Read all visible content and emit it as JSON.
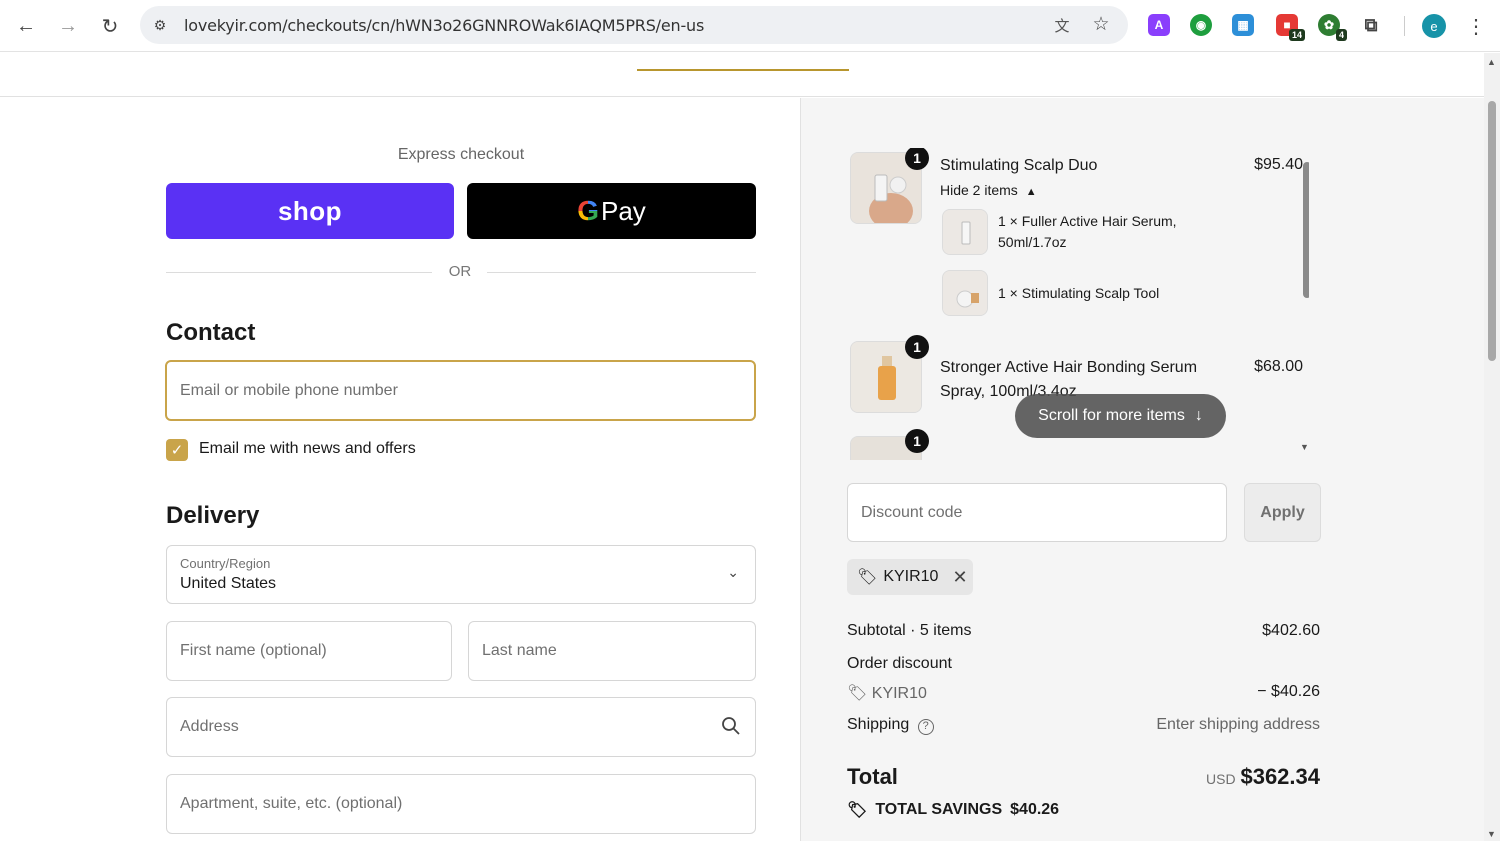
{
  "browser": {
    "url": "lovekyir.com/checkouts/cn/hWN3o26GNNROWak6IAQM5PRS/en-us",
    "extensions": [
      {
        "name": "a-extension-icon",
        "glyph": "A",
        "color": "#8a3ffc"
      },
      {
        "name": "green-extension-icon",
        "glyph": "◉",
        "color": "#1e9e3e"
      },
      {
        "name": "grid-extension-icon",
        "glyph": "▦",
        "color": "#2d8fd8"
      },
      {
        "name": "red-extension-icon",
        "glyph": "■",
        "color": "#e53935",
        "badge": "14"
      },
      {
        "name": "puzzle-green-extension-icon",
        "glyph": "✿",
        "color": "#2e7d32",
        "badge": "4"
      }
    ],
    "avatar_letter": "e"
  },
  "checkout": {
    "express_title": "Express checkout",
    "shop_label": "shop",
    "gpay_label": "Pay",
    "gpay_g": "G",
    "or_label": "OR",
    "contact_heading": "Contact",
    "email_placeholder": "Email or mobile phone number",
    "newsletter_label": "Email me with news and offers",
    "newsletter_checked": true,
    "delivery_heading": "Delivery",
    "country_label": "Country/Region",
    "country_value": "United States",
    "first_name_placeholder": "First name (optional)",
    "last_name_placeholder": "Last name",
    "address_placeholder": "Address",
    "apartment_placeholder": "Apartment, suite, etc. (optional)"
  },
  "summary": {
    "items": [
      {
        "qty": "1",
        "title": "Stimulating Scalp Duo",
        "price": "$95.40",
        "toggle_label": "Hide 2 items",
        "sub_items": [
          {
            "text": "1 × Fuller Active Hair Serum, 50ml/1.7oz"
          },
          {
            "text": "1 × Stimulating Scalp Tool"
          }
        ]
      },
      {
        "qty": "1",
        "title": "Stronger Active Hair Bonding Serum Spray, 100ml/3.4oz",
        "price": "$68.00"
      },
      {
        "qty": "1"
      }
    ],
    "scroll_hint": "Scroll for more items",
    "discount_placeholder": "Discount code",
    "apply_label": "Apply",
    "applied_code": "KYIR10",
    "subtotal_label": "Subtotal · 5 items",
    "subtotal_value": "$402.60",
    "order_discount_label": "Order discount",
    "discount_code": "KYIR10",
    "discount_value": "− $40.26",
    "shipping_label": "Shipping",
    "shipping_value": "Enter shipping address",
    "total_label": "Total",
    "currency": "USD",
    "total_value": "$362.34",
    "savings_label": "TOTAL SAVINGS",
    "savings_value": "$40.26"
  },
  "colors": {
    "accent": "#c9a44a",
    "shop_purple": "#5a31f4",
    "gpay_black": "#000000"
  }
}
